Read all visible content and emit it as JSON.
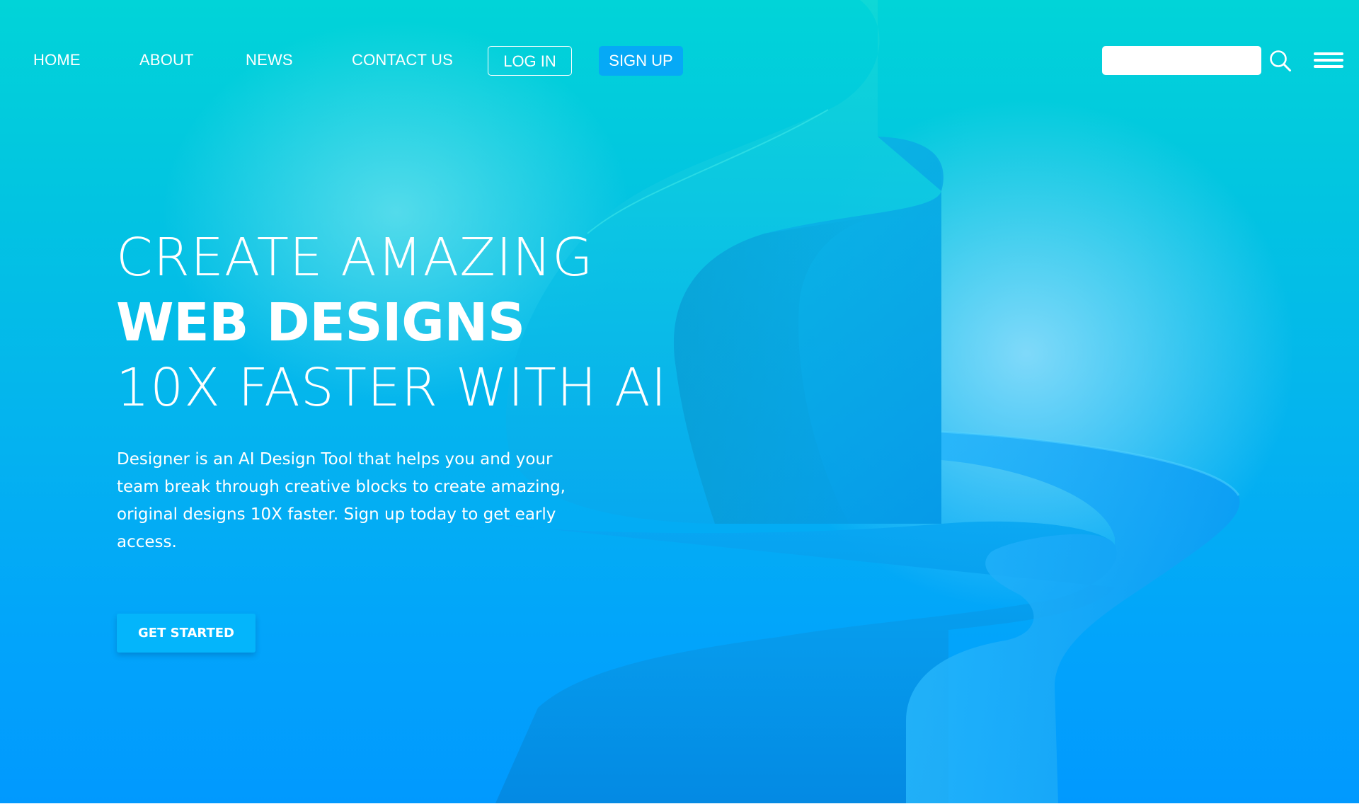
{
  "nav": {
    "links": [
      {
        "label": "HOME"
      },
      {
        "label": "ABOUT"
      },
      {
        "label": "NEWS"
      },
      {
        "label": "CONTACT US"
      }
    ],
    "login_label": "LOG IN",
    "signup_label": "SIGN UP",
    "search": {
      "value": "",
      "placeholder": "",
      "icon": "search-icon"
    },
    "menu_icon": "hamburger-menu-icon"
  },
  "hero": {
    "headline": {
      "line1": "CREATE AMAZING",
      "line2": "WEB DESIGNS",
      "line3": "10X FASTER WITH AI"
    },
    "description": "Designer is an AI Design Tool that helps you and your team break through creative blocks to create amazing, original designs 10X faster. Sign up today to get early access.",
    "cta_label": "GET STARTED"
  },
  "colors": {
    "background_top": "#01d4d8",
    "background_bottom": "#0199fe",
    "signup_button": "#06a9f6",
    "cta_button": "#04b5fb",
    "text": "#ffffff"
  }
}
